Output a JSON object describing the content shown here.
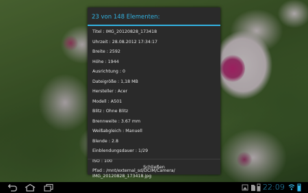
{
  "dialog": {
    "title": "23 von 148 Elementen:",
    "rows": [
      {
        "label": "Titel",
        "value": "IMG_20120828_173418"
      },
      {
        "label": "Uhrzeit",
        "value": "28.08.2012 17:34:17"
      },
      {
        "label": "Breite",
        "value": "2592"
      },
      {
        "label": "Höhe",
        "value": "1944"
      },
      {
        "label": "Ausrichtung",
        "value": "0"
      },
      {
        "label": "Dateigröße",
        "value": "1,18 MB"
      },
      {
        "label": "Hersteller",
        "value": "Acer"
      },
      {
        "label": "Modell",
        "value": "A501"
      },
      {
        "label": "Blitz",
        "value": "Ohne Blitz"
      },
      {
        "label": "Brennweite",
        "value": "3.67 mm"
      },
      {
        "label": "Weißabgleich",
        "value": "Manuell"
      },
      {
        "label": "Blende",
        "value": "2.8"
      },
      {
        "label": "Einblendungsdauer",
        "value": "1/29"
      },
      {
        "label": "ISO",
        "value": "100"
      },
      {
        "label": "Pfad",
        "value": "/mnt/external_sd/DCIM/Camera/ IMG_20120828_173418.jpg"
      }
    ],
    "close_label": "Schließen"
  },
  "navbar": {
    "back_icon": "back-icon",
    "home_icon": "home-icon",
    "recent_icon": "recent-apps-icon"
  },
  "status_bar": {
    "clock": "22:09",
    "accent": "#33b5e5"
  }
}
